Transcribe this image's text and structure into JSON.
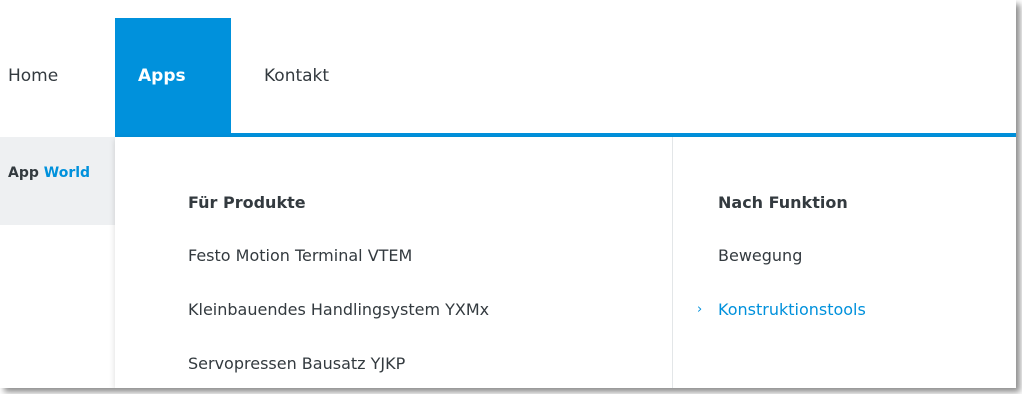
{
  "nav": {
    "home": "Home",
    "apps": "Apps",
    "contact": "Kontakt"
  },
  "sidebar": {
    "app_prefix": "App",
    "app_world": "World"
  },
  "menu": {
    "products": {
      "heading": "Für Produkte",
      "items": [
        "Festo Motion Terminal VTEM",
        "Kleinbauendes Handlingsystem YXMx",
        "Servopressen Bausatz YJKP"
      ]
    },
    "functions": {
      "heading": "Nach Funktion",
      "items": [
        "Bewegung",
        "Konstruktionstools"
      ],
      "active_index": 1
    }
  },
  "colors": {
    "accent": "#0091dc",
    "text": "#333a3f",
    "band": "#eef0f2"
  },
  "icons": {
    "active_marker": "chevron-right-icon"
  }
}
